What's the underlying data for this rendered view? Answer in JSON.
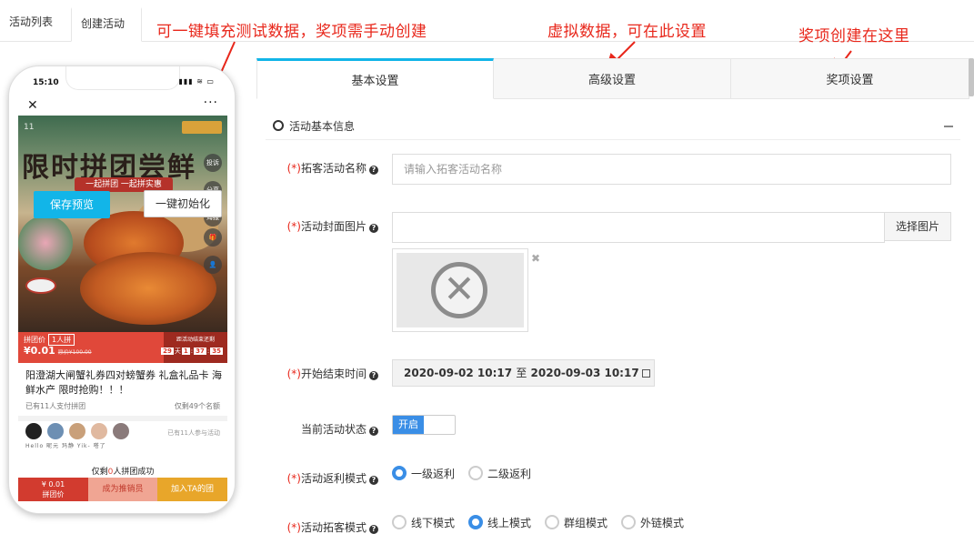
{
  "top_tabs": [
    {
      "label": "活动列表"
    },
    {
      "label": "创建活动"
    }
  ],
  "annotations": {
    "a1": "可一键填充测试数据，奖项需手动创建",
    "a2": "虚拟数据，可在此设置",
    "a3": "奖项创建在这里"
  },
  "phone": {
    "status_time": "15:10",
    "status_icons": "▮▮▮ ≋ ▭",
    "close": "✕",
    "more": "···",
    "save_preview_button": "保存预览",
    "init_button": "一键初始化",
    "banner_title": "限时拼团尝鲜",
    "banner_ribbon": "一起拼团 一起拼实惠",
    "banner_top": "11",
    "side_buttons": [
      "投诉",
      "分享",
      "海报",
      "🎁",
      "👤"
    ],
    "price_label": "拼团价",
    "price_tag": "1人拼",
    "price_value": "¥0.01",
    "price_old": "原价¥100.00",
    "right_label": "距活动结束还剩",
    "countdown": [
      "29",
      "天",
      "1",
      "37",
      "35"
    ],
    "product_title": "阳澄湖大闸蟹礼券四对螃蟹券 礼盒礼品卡 海鲜水产 限时抢购！！！",
    "meta_left": "已有11人支付拼团",
    "meta_right": "仅剩49个名额",
    "avatar_names": "Hello  昵元   玛静   Yik-   嗒了",
    "avatar_right": "已有11人参与活动",
    "remaining_prefix": "仅剩",
    "remaining_count": "0",
    "remaining_suffix": "人拼团成功",
    "bottom": {
      "b1_price": "¥ 0.01",
      "b1_label": "拼团价",
      "b2": "成为推销员",
      "b3": "加入TA的团"
    }
  },
  "panel": {
    "tabs": [
      {
        "label": "基本设置"
      },
      {
        "label": "高级设置"
      },
      {
        "label": "奖项设置"
      }
    ],
    "section_title": "活动基本信息",
    "fields": {
      "name_label": "拓客活动名称",
      "name_placeholder": "请输入拓客活动名称",
      "cover_label": "活动封面图片",
      "cover_button": "选择图片",
      "time_label": "开始结束时间",
      "time_start": "2020-09-02 10:17",
      "time_sep": "至",
      "time_end": "2020-09-03 10:17",
      "status_label": "当前活动状态",
      "status_value": "开启",
      "rebate_label": "活动返利模式",
      "rebate_options": [
        "一级返利",
        "二级返利"
      ],
      "mode_label": "活动拓客模式",
      "mode_options": [
        "线下模式",
        "线上模式",
        "群组模式",
        "外链模式"
      ]
    },
    "required_mark": "(*)",
    "help_mark": "?"
  }
}
